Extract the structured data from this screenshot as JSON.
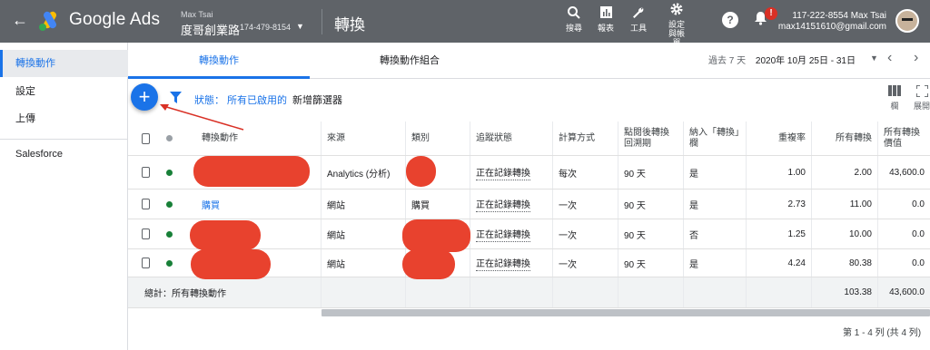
{
  "header": {
    "brand": "Google Ads",
    "account_user": "Max Tsai",
    "account_name": "度哥創業路",
    "account_id": "174-479-8154",
    "page_title": "轉換",
    "tools": [
      {
        "icon": "search-icon",
        "label": "搜尋"
      },
      {
        "icon": "reports-icon",
        "label": "報表"
      },
      {
        "icon": "wrench-icon",
        "label": "工具"
      },
      {
        "icon": "gear-icon",
        "label": "設定與帳單"
      }
    ],
    "notif_badge": "!",
    "user_line1": "117-222-8554 Max Tsai",
    "user_line2": "max14151610@gmail.com"
  },
  "sidebar": {
    "items": [
      {
        "label": "轉換動作",
        "active": true
      },
      {
        "label": "設定",
        "active": false
      },
      {
        "label": "上傳",
        "active": false
      },
      {
        "label": "Salesforce",
        "active": false
      }
    ]
  },
  "tabs": [
    {
      "label": "轉換動作",
      "active": true
    },
    {
      "label": "轉換動作組合",
      "active": false
    }
  ],
  "date": {
    "preset": "過去 7 天",
    "range": "2020年 10月 25日 - 31日"
  },
  "toolbar": {
    "add_label": "+",
    "filter_label": "狀態： 所有已啟用的",
    "add_filter": "新增篩選器",
    "columns_label": "欄",
    "expand_label": "展開"
  },
  "table": {
    "headers": [
      "轉換動作",
      "來源",
      "類別",
      "追蹤狀態",
      "計算方式",
      "點閱後轉換回溯期",
      "納入「轉換」欄",
      "重複率",
      "所有轉換",
      "所有轉換價值"
    ],
    "rows": [
      {
        "name": "",
        "source": "Analytics (分析)",
        "category": "",
        "status": "正在記錄轉換",
        "count": "每次",
        "window": "90 天",
        "include": "是",
        "repeat": "1.00",
        "all_conv": "2.00",
        "value": "43,600.0"
      },
      {
        "name": "購買",
        "source": "網站",
        "category": "購買",
        "status": "正在記錄轉換",
        "count": "一次",
        "window": "90 天",
        "include": "是",
        "repeat": "2.73",
        "all_conv": "11.00",
        "value": "0.0"
      },
      {
        "name": "",
        "source": "網站",
        "category": "",
        "status": "正在記錄轉換",
        "count": "一次",
        "window": "90 天",
        "include": "否",
        "repeat": "1.25",
        "all_conv": "10.00",
        "value": "0.0"
      },
      {
        "name": "",
        "source": "網站",
        "category": "",
        "status": "正在記錄轉換",
        "count": "一次",
        "window": "90 天",
        "include": "是",
        "repeat": "4.24",
        "all_conv": "80.38",
        "value": "0.0"
      }
    ],
    "total_label": "總計：所有轉換動作",
    "total_all_conv": "103.38",
    "total_value": "43,600.0"
  },
  "pager": "第 1 - 4 列 (共 4 列)",
  "colors": {
    "accent": "#1a73e8",
    "topbar": "#5f6368",
    "redaction": "#e8422e",
    "status_dot": "#188038"
  }
}
